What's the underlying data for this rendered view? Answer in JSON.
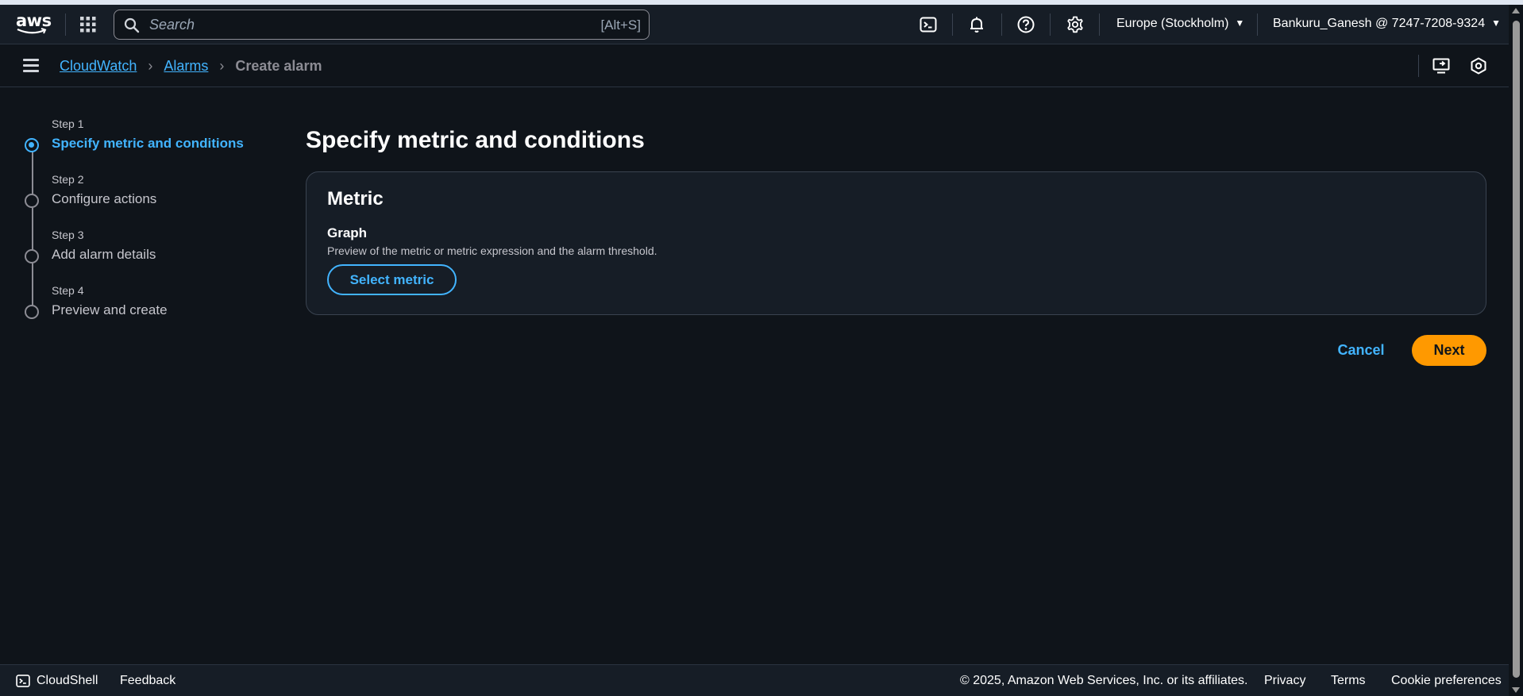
{
  "topnav": {
    "logo_text": "aws",
    "search_placeholder": "Search",
    "search_shortcut": "[Alt+S]",
    "icons": [
      "cloudshell-icon",
      "bell-icon",
      "help-icon",
      "gear-icon"
    ],
    "region": "Europe (Stockholm)",
    "account": "Bankuru_Ganesh @ 7247-7208-9324"
  },
  "breadcrumb": {
    "items": [
      "CloudWatch",
      "Alarms"
    ],
    "current": "Create alarm"
  },
  "steps": [
    {
      "number": "Step 1",
      "title": "Specify metric and conditions",
      "active": true
    },
    {
      "number": "Step 2",
      "title": "Configure actions",
      "active": false
    },
    {
      "number": "Step 3",
      "title": "Add alarm details",
      "active": false
    },
    {
      "number": "Step 4",
      "title": "Preview and create",
      "active": false
    }
  ],
  "main": {
    "title": "Specify metric and conditions",
    "container": {
      "heading": "Metric",
      "graph_label": "Graph",
      "graph_description": "Preview of the metric or metric expression and the alarm threshold.",
      "select_button": "Select metric"
    },
    "cancel_label": "Cancel",
    "next_label": "Next"
  },
  "footer": {
    "cloudshell": "CloudShell",
    "feedback": "Feedback",
    "copyright": "© 2025, Amazon Web Services, Inc. or its affiliates.",
    "privacy": "Privacy",
    "terms": "Terms",
    "cookie": "Cookie preferences"
  },
  "colors": {
    "background": "#0f141a",
    "accent_link": "#42b4ff",
    "primary_button": "#ff9900"
  }
}
